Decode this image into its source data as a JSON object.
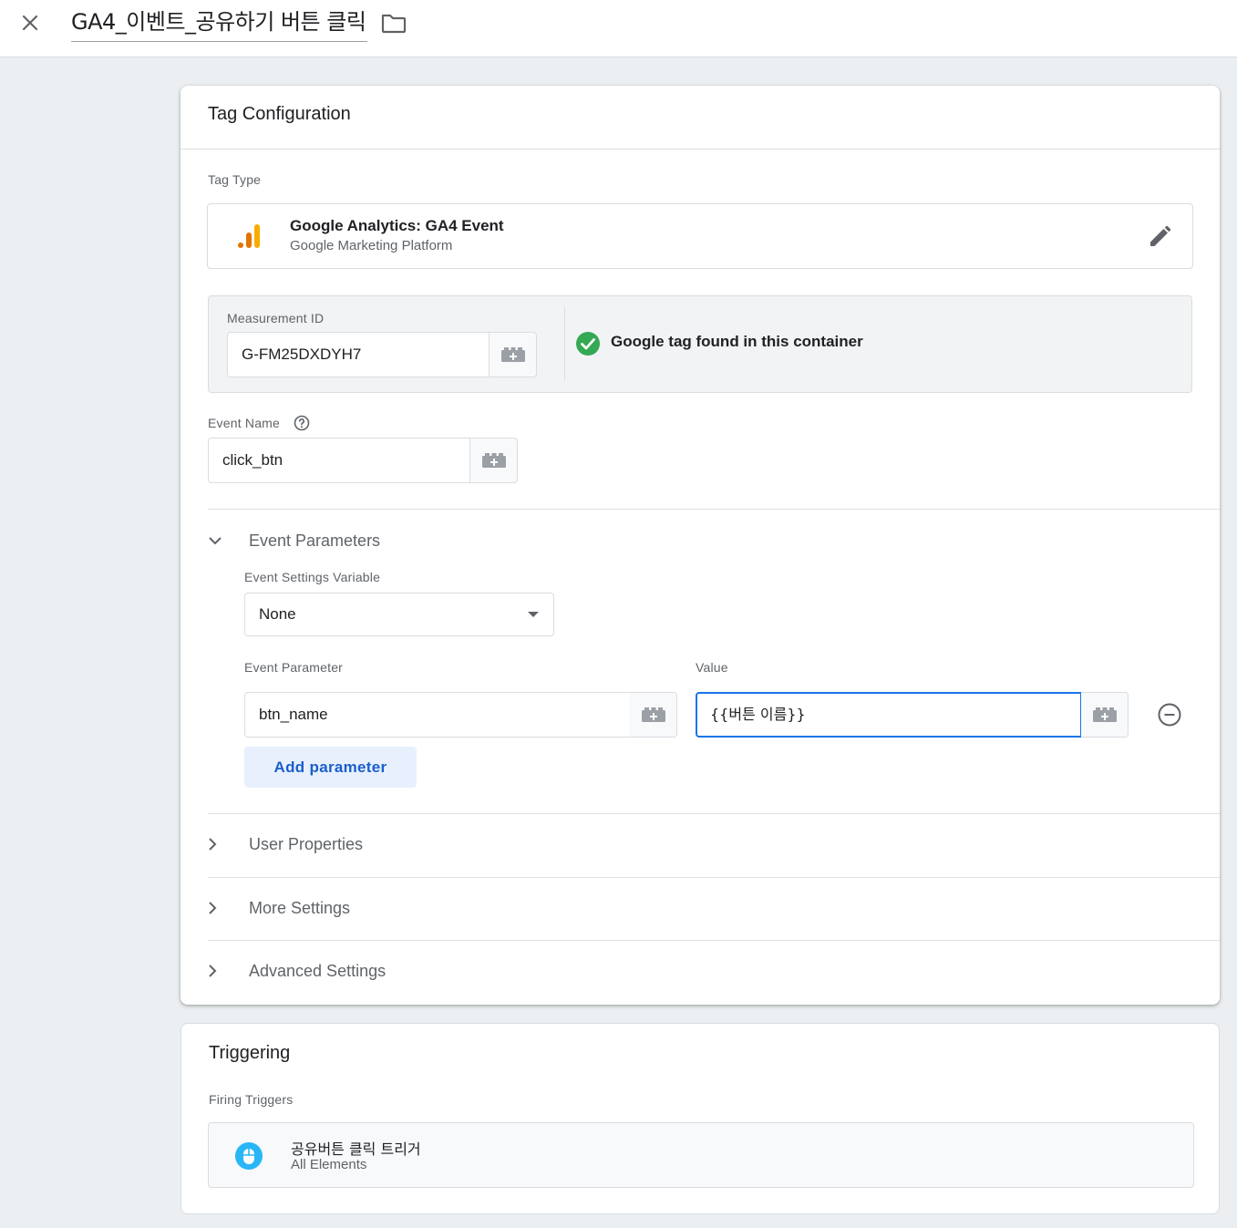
{
  "header": {
    "tag_name": "GA4_이벤트_공유하기 버튼 클릭",
    "icons": {
      "close": "close-icon",
      "folder": "folder-icon"
    }
  },
  "tag_configuration": {
    "title": "Tag Configuration",
    "tag_type_label": "Tag Type",
    "tag_type": {
      "name": "Google Analytics: GA4 Event",
      "platform": "Google Marketing Platform",
      "icon": "google-analytics-icon"
    },
    "measurement_id": {
      "label": "Measurement ID",
      "value": "G-FM25DXDYH7"
    },
    "google_tag_status": "Google tag found in this container",
    "event_name": {
      "label": "Event Name",
      "value": "click_btn"
    },
    "event_parameters": {
      "title": "Event Parameters",
      "settings_variable_label": "Event Settings Variable",
      "settings_variable_value": "None",
      "parameter_col_label": "Event Parameter",
      "value_col_label": "Value",
      "rows": [
        {
          "parameter": "btn_name",
          "value": "{{버튼 이름}}"
        }
      ],
      "add_button": "Add parameter"
    },
    "collapsed_sections": [
      {
        "title": "User Properties"
      },
      {
        "title": "More Settings"
      },
      {
        "title": "Advanced Settings"
      }
    ]
  },
  "triggering": {
    "title": "Triggering",
    "firing_label": "Firing Triggers",
    "trigger": {
      "name": "공유버튼 클릭 트리거",
      "type": "All Elements",
      "icon": "mouse-click-icon"
    }
  },
  "colors": {
    "accent_blue": "#1a73e8",
    "success_green": "#34a853",
    "ga_orange": "#f9ab00",
    "ga_dark_orange": "#e37400",
    "trigger_blue": "#29b6f6"
  }
}
